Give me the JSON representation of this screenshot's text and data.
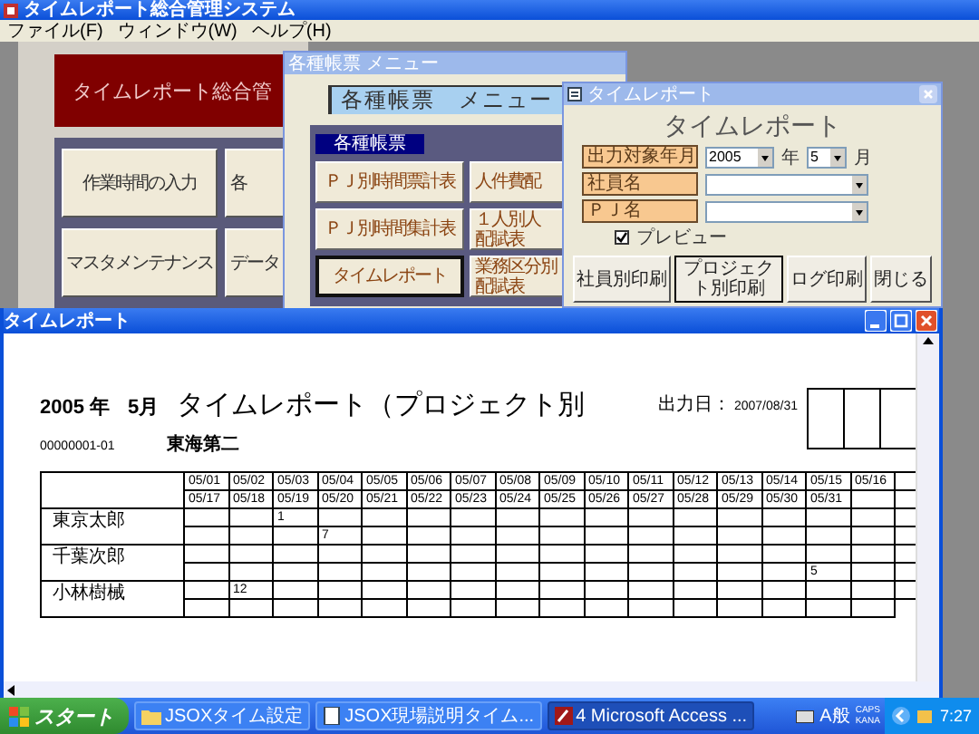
{
  "app": {
    "title": "タイムレポート総合管理システム",
    "menu": [
      "ファイル(F)",
      "ウィンドウ(W)",
      "ヘルプ(H)"
    ]
  },
  "main_form": {
    "banner": "タイムレポート総合管",
    "buttons": [
      "作業時間の入力",
      "各",
      "マスタメンテナンス",
      "データ"
    ]
  },
  "menu_window": {
    "title": "各種帳票 メニュー",
    "heading": "各種帳票　メニュー",
    "group_label": "各種帳票",
    "buttons": [
      {
        "lines": [
          "ＰＪ別時間票計表"
        ],
        "selected": false
      },
      {
        "lines": [
          "人件費配"
        ],
        "selected": false
      },
      {
        "lines": [
          "ＰＪ別時間集計表"
        ],
        "selected": false
      },
      {
        "lines": [
          "１人別人",
          "配賦表"
        ],
        "selected": false
      },
      {
        "lines": [
          "タイムレポート"
        ],
        "selected": true
      },
      {
        "lines": [
          "業務区分別",
          "配賦表"
        ],
        "selected": false
      }
    ]
  },
  "dialog": {
    "title": "タイムレポート",
    "heading": "タイムレポート",
    "period": {
      "label": "出力対象年月",
      "year": "2005",
      "year_unit": "年",
      "month": "5",
      "month_unit": "月"
    },
    "employee": {
      "label": "社員名"
    },
    "project": {
      "label": "ＰＪ名"
    },
    "preview": {
      "label": "プレビュー",
      "checked": true
    },
    "buttons": [
      {
        "label": "社員別印刷",
        "selected": false
      },
      {
        "label": "プロジェクト別印刷",
        "selected": true
      },
      {
        "label": "ログ印刷",
        "selected": false
      },
      {
        "label": "閉じる",
        "selected": false
      }
    ]
  },
  "report_window": {
    "title": "タイムレポート",
    "report": {
      "year": "2005 年",
      "month": "5月",
      "title": "タイムレポート（プロジェクト別",
      "output_date_label": "出力日：",
      "output_date": "2007/08/31",
      "code": "00000001-01",
      "site": "東海第二",
      "dates_upper": [
        "05/01",
        "05/02",
        "05/03",
        "05/04",
        "05/05",
        "05/06",
        "05/07",
        "05/08",
        "05/09",
        "05/10",
        "05/11",
        "05/12",
        "05/13",
        "05/14",
        "05/15",
        "05/16"
      ],
      "dates_lower": [
        "05/17",
        "05/18",
        "05/19",
        "05/20",
        "05/21",
        "05/22",
        "05/23",
        "05/24",
        "05/25",
        "05/26",
        "05/27",
        "05/28",
        "05/29",
        "05/30",
        "05/31"
      ],
      "people": [
        {
          "name": "東京太郎",
          "upper": [
            {
              "kind": "blank"
            },
            {
              "kind": "blank"
            },
            {
              "kind": "hours",
              "hours": "1"
            },
            {
              "kind": "blank"
            },
            {
              "kind": "blank"
            },
            {
              "kind": "blank"
            },
            {
              "kind": "blank"
            },
            {
              "kind": "blank"
            },
            {
              "kind": "blank"
            },
            {
              "kind": "blank"
            },
            {
              "kind": "blank"
            },
            {
              "kind": "blank"
            },
            {
              "kind": "blank"
            },
            {
              "kind": "blank"
            },
            {
              "kind": "blank"
            },
            {
              "kind": "blank"
            }
          ],
          "lower": [
            {
              "kind": "blank"
            },
            {
              "kind": "blank"
            },
            {
              "kind": "blank"
            },
            {
              "kind": "hours",
              "hours": "7"
            },
            {
              "kind": "blank"
            },
            {
              "kind": "blank"
            },
            {
              "kind": "blank"
            },
            {
              "kind": "blank"
            },
            {
              "kind": "blank"
            },
            {
              "kind": "blank"
            },
            {
              "kind": "blank"
            },
            {
              "kind": "blank"
            },
            {
              "kind": "blank"
            },
            {
              "kind": "blank"
            },
            {
              "kind": "blank"
            },
            {
              "kind": "blank"
            }
          ]
        },
        {
          "name": "千葉次郎",
          "upper": [
            {
              "kind": "blank"
            },
            {
              "kind": "blank"
            },
            {
              "kind": "blank"
            },
            {
              "kind": "blank"
            },
            {
              "kind": "blank"
            },
            {
              "kind": "blank"
            },
            {
              "kind": "blank"
            },
            {
              "kind": "blank"
            },
            {
              "kind": "blank"
            },
            {
              "kind": "blank"
            },
            {
              "kind": "blank"
            },
            {
              "kind": "blank"
            },
            {
              "kind": "blank"
            },
            {
              "kind": "blank"
            },
            {
              "kind": "blank"
            },
            {
              "kind": "blank"
            }
          ],
          "lower": [
            {
              "kind": "blank"
            },
            {
              "kind": "blank"
            },
            {
              "kind": "blank"
            },
            {
              "kind": "blank"
            },
            {
              "kind": "blank"
            },
            {
              "kind": "blank"
            },
            {
              "kind": "blank"
            },
            {
              "kind": "blank"
            },
            {
              "kind": "blank"
            },
            {
              "kind": "blank"
            },
            {
              "kind": "blank"
            },
            {
              "kind": "blank"
            },
            {
              "kind": "blank"
            },
            {
              "kind": "blank"
            },
            {
              "kind": "hours",
              "hours": "5"
            },
            {
              "kind": "blank"
            }
          ]
        },
        {
          "name": "小林樹械",
          "upper": [
            {
              "kind": "blank"
            },
            {
              "kind": "hours",
              "hours": "12"
            },
            {
              "kind": "blank"
            },
            {
              "kind": "blank"
            },
            {
              "kind": "blank"
            },
            {
              "kind": "blank"
            },
            {
              "kind": "blank"
            },
            {
              "kind": "blank"
            },
            {
              "kind": "blank"
            },
            {
              "kind": "blank"
            },
            {
              "kind": "blank"
            },
            {
              "kind": "blank"
            },
            {
              "kind": "blank"
            },
            {
              "kind": "blank"
            },
            {
              "kind": "blank"
            },
            {
              "kind": "blank"
            }
          ],
          "lower": [
            {
              "kind": "blank"
            },
            {
              "kind": "blank"
            },
            {
              "kind": "blank"
            },
            {
              "kind": "blank"
            },
            {
              "kind": "blank"
            },
            {
              "kind": "blank"
            },
            {
              "kind": "blank"
            },
            {
              "kind": "blank"
            },
            {
              "kind": "blank"
            },
            {
              "kind": "blank"
            },
            {
              "kind": "blank"
            },
            {
              "kind": "blank"
            },
            {
              "kind": "blank"
            },
            {
              "kind": "blank"
            },
            {
              "kind": "blank"
            },
            {
              "kind": "blank"
            }
          ]
        }
      ]
    }
  },
  "taskbar": {
    "start": "スタート",
    "tasks": [
      {
        "kind": "folder",
        "label": "JSOXタイム設定",
        "selected": false
      },
      {
        "kind": "document",
        "label": "JSOX現場説明タイム...",
        "selected": false
      },
      {
        "kind": "access",
        "label": "4 Microsoft Access ...",
        "selected": true
      }
    ],
    "ime": "A般",
    "caps": "CAPS",
    "kana": "KANA",
    "clock": "7:27"
  }
}
